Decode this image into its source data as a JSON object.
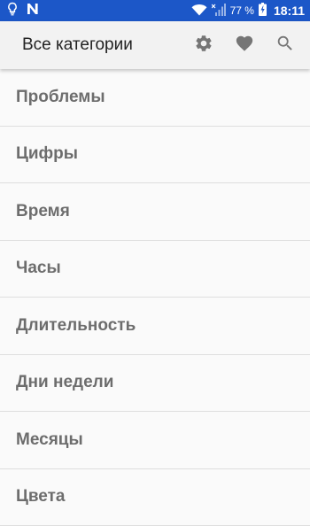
{
  "status_bar": {
    "left_icons": [
      "lightbulb-icon",
      "n-notification-icon"
    ],
    "battery_percent": "77 %",
    "time": "18:11",
    "color": "#1c57c8"
  },
  "app_bar": {
    "title": "Все категории",
    "actions": [
      "gear-icon",
      "heart-icon",
      "search-icon"
    ],
    "icon_color": "#757575"
  },
  "categories": [
    {
      "label": "Проблемы"
    },
    {
      "label": "Цифры"
    },
    {
      "label": "Время"
    },
    {
      "label": "Часы"
    },
    {
      "label": "Длительность"
    },
    {
      "label": "Дни недели"
    },
    {
      "label": "Месяцы"
    },
    {
      "label": "Цвета"
    }
  ]
}
